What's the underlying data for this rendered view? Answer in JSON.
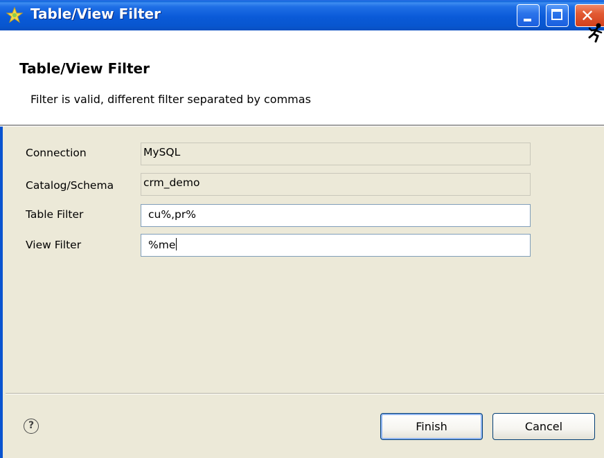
{
  "window": {
    "title": "Table/View Filter",
    "title_icon": "wizard-star-icon",
    "controls": {
      "minimize_icon": "minimize-icon",
      "maximize_icon": "maximize-icon",
      "close_icon": "close-icon",
      "close_glyph": "✕"
    }
  },
  "header": {
    "title": "Table/View Filter",
    "message": "Filter is valid, different filter separated by commas",
    "wizard_icon": "running-figure-icon"
  },
  "form": {
    "connection": {
      "label": "Connection",
      "value": "MySQL"
    },
    "catalog_schema": {
      "label": "Catalog/Schema",
      "value": "crm_demo"
    },
    "table_filter": {
      "label": "Table Filter",
      "value": "cu%,pr%"
    },
    "view_filter": {
      "label": "View Filter",
      "value": "%me"
    }
  },
  "footer": {
    "help_icon": "help-icon",
    "help_glyph": "?",
    "finish_label": "Finish",
    "cancel_label": "Cancel"
  },
  "colors": {
    "titlebar": "#0a5ad8",
    "body_bg": "#ece9d8",
    "close_button": "#e25a33"
  }
}
